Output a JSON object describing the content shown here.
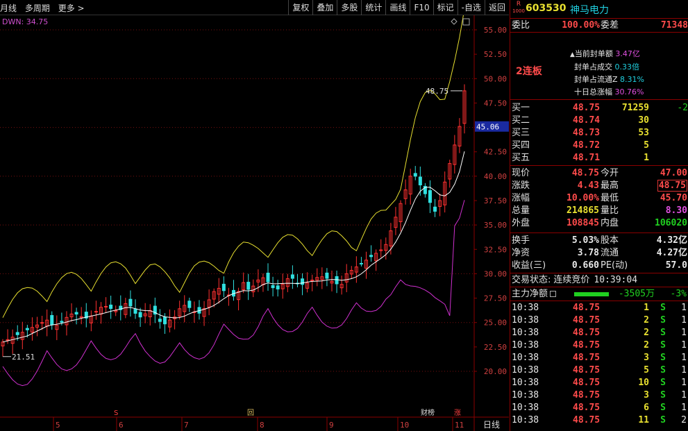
{
  "toolbar": {
    "left": [
      "月线",
      "多周期",
      "更多 >"
    ],
    "right": [
      "复权",
      "叠加",
      "多股",
      "统计",
      "画线",
      "F10",
      "标记",
      "-自选",
      "返回"
    ]
  },
  "chart": {
    "indicator_label": "DWN: 34.75",
    "price_ticks": [
      "55.00",
      "52.50",
      "50.00",
      "47.50",
      "45.00",
      "42.50",
      "40.00",
      "37.50",
      "35.00",
      "32.50",
      "30.00",
      "27.50",
      "25.00",
      "22.50",
      "20.00"
    ],
    "current_price_tag": "45.06",
    "high_marker": "48.75",
    "low_marker": "21.51",
    "x_labels": [
      "5",
      "6",
      "7",
      "8",
      "9",
      "10",
      "11"
    ],
    "period_label": "日线",
    "event_markers": [
      "S",
      "S",
      "回",
      "财榜",
      "涨"
    ]
  },
  "stock": {
    "r_badge": "R",
    "code": "603530",
    "name": "神马电力",
    "weibi_label": "委比",
    "weibi": "100.00%",
    "weicha_label": "委差",
    "weicha": "71348"
  },
  "seal": {
    "badge": "2连板",
    "items": [
      {
        "label": "当前封单额",
        "value": "3.47亿"
      },
      {
        "label": "封单占成交",
        "value": "0.33倍"
      },
      {
        "label": "封单占流通Z",
        "value": "8.31%"
      },
      {
        "label": "十日总涨幅",
        "value": "30.76%"
      }
    ]
  },
  "bids": [
    {
      "label": "买一",
      "price": "48.75",
      "vol": "71259",
      "chg": "-2"
    },
    {
      "label": "买二",
      "price": "48.74",
      "vol": "30",
      "chg": ""
    },
    {
      "label": "买三",
      "price": "48.73",
      "vol": "53",
      "chg": ""
    },
    {
      "label": "买四",
      "price": "48.72",
      "vol": "5",
      "chg": ""
    },
    {
      "label": "买五",
      "price": "48.71",
      "vol": "1",
      "chg": ""
    }
  ],
  "quote": [
    {
      "l1": "现价",
      "v1": "48.75",
      "l2": "今开",
      "v2": "47.00"
    },
    {
      "l1": "涨跌",
      "v1": "4.43",
      "l2": "最高",
      "v2": "48.75"
    },
    {
      "l1": "涨幅",
      "v1": "10.00%",
      "l2": "最低",
      "v2": "45.70"
    },
    {
      "l1": "总量",
      "v1": "214865",
      "l2": "量比",
      "v2": "8.30"
    },
    {
      "l1": "外盘",
      "v1": "108845",
      "l2": "内盘",
      "v2": "106020"
    }
  ],
  "fund": [
    {
      "l1": "换手",
      "v1": "5.03%",
      "l2": "股本",
      "v2": "4.32亿"
    },
    {
      "l1": "净资",
      "v1": "3.78",
      "l2": "流通",
      "v2": "4.27亿"
    },
    {
      "l1": "收益(三)",
      "v1": "0.660",
      "l2": "PE(动)",
      "v2": "57.0"
    }
  ],
  "status": {
    "label": "交易状态:",
    "value": "连续竞价",
    "time": "10:39:04"
  },
  "mainflow": {
    "label": "主力净额",
    "value": "-3505万",
    "pct": "-3%"
  },
  "ticks": [
    {
      "time": "10:38",
      "price": "48.75",
      "vol": "1",
      "side": "S",
      "n": "1"
    },
    {
      "time": "10:38",
      "price": "48.75",
      "vol": "2",
      "side": "S",
      "n": "1"
    },
    {
      "time": "10:38",
      "price": "48.75",
      "vol": "2",
      "side": "S",
      "n": "1"
    },
    {
      "time": "10:38",
      "price": "48.75",
      "vol": "2",
      "side": "S",
      "n": "1"
    },
    {
      "time": "10:38",
      "price": "48.75",
      "vol": "3",
      "side": "S",
      "n": "1"
    },
    {
      "time": "10:38",
      "price": "48.75",
      "vol": "5",
      "side": "S",
      "n": "1"
    },
    {
      "time": "10:38",
      "price": "48.75",
      "vol": "10",
      "side": "S",
      "n": "1"
    },
    {
      "time": "10:38",
      "price": "48.75",
      "vol": "3",
      "side": "S",
      "n": "1"
    },
    {
      "time": "10:38",
      "price": "48.75",
      "vol": "6",
      "side": "S",
      "n": "1"
    },
    {
      "time": "10:38",
      "price": "48.75",
      "vol": "11",
      "side": "S",
      "n": "2"
    }
  ]
}
